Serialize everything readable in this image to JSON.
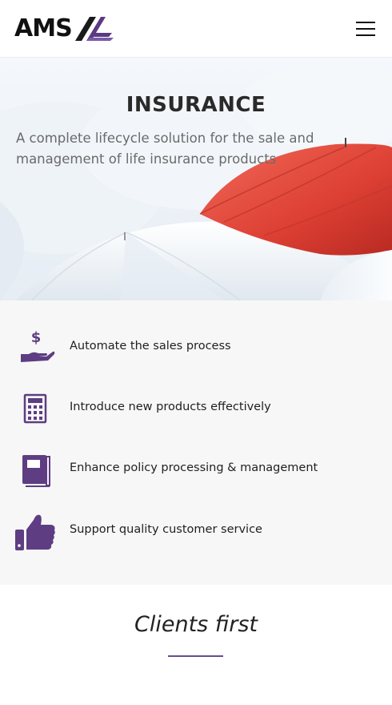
{
  "header": {
    "logo_text": "AMS",
    "menu_icon": "hamburger-menu-icon"
  },
  "hero": {
    "title": "INSURANCE",
    "subtitle": "A complete lifecycle solution for the sale and management of life insurance products"
  },
  "features": [
    {
      "icon": "hand-dollar-icon",
      "label": "Automate the sales process"
    },
    {
      "icon": "calculator-icon",
      "label": "Introduce new products effectively"
    },
    {
      "icon": "book-icon",
      "label": "Enhance policy processing & management"
    },
    {
      "icon": "thumbs-up-icon",
      "label": "Support quality customer service"
    }
  ],
  "clients": {
    "title": "Clients first"
  },
  "colors": {
    "accent": "#6b4a8f",
    "umbrella_red": "#e2483b",
    "features_bg": "#f7f7f7"
  }
}
